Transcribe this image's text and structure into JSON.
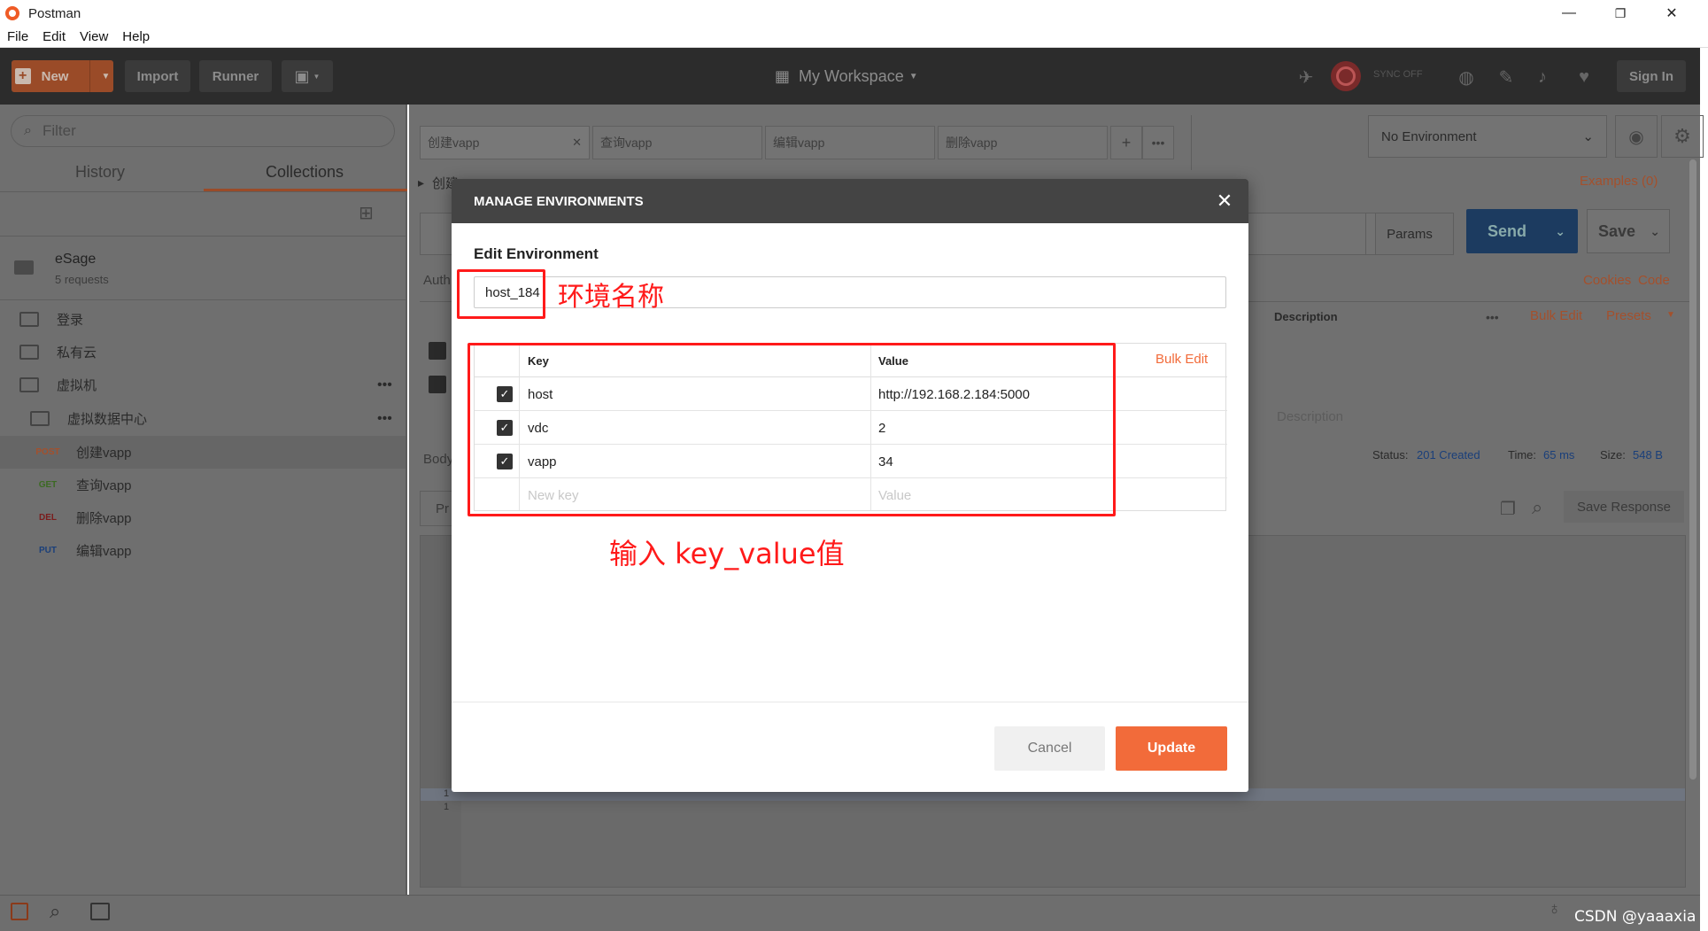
{
  "window": {
    "title": "Postman",
    "minimize": "—",
    "restore": "❐",
    "close": "✕"
  },
  "menu": [
    "File",
    "Edit",
    "View",
    "Help"
  ],
  "toolbar": {
    "new_label": "New",
    "new_icon": "plus-icon",
    "import_label": "Import",
    "runner_label": "Runner",
    "workspace_label": "My Workspace",
    "sync_label": "SYNC OFF",
    "signin_label": "Sign In"
  },
  "sidebar": {
    "filter_placeholder": "Filter",
    "tabs": [
      "History",
      "Collections"
    ],
    "collection": {
      "name": "eSage",
      "count": "5 requests"
    },
    "folders": [
      "登录",
      "私有云",
      "虚拟机",
      "虚拟数据中心"
    ],
    "requests": [
      {
        "method": "POST",
        "name": "创建vapp",
        "color": "#a4502c"
      },
      {
        "method": "GET",
        "name": "查询vapp",
        "color": "#3b6a22"
      },
      {
        "method": "DEL",
        "name": "删除vapp",
        "color": "#7a1d1d"
      },
      {
        "method": "PUT",
        "name": "编辑vapp",
        "color": "#1a3f7a"
      }
    ]
  },
  "main": {
    "tabs": [
      "创建vapp",
      "查询vapp",
      "编辑vapp",
      "删除vapp"
    ],
    "request_title": "创建",
    "env_select": "No Environment",
    "examples": "Examples (0)",
    "params": "Params",
    "send": "Send",
    "save": "Save",
    "cookies": "Cookies",
    "code": "Code",
    "auth_tab": "Auth",
    "description_col": "Description",
    "bulk_edit": "Bulk Edit",
    "presets": "Presets",
    "description_placeholder": "Description",
    "body_tab": "Body",
    "pretty_tab": "Pr",
    "status_label": "Status:",
    "status_value": "201 Created",
    "time_label": "Time:",
    "time_value": "65 ms",
    "size_label": "Size:",
    "size_value": "548 B",
    "save_response": "Save Response",
    "line_numbers": [
      "1",
      "1"
    ]
  },
  "modal": {
    "title": "MANAGE ENVIRONMENTS",
    "edit_label": "Edit Environment",
    "env_name": "host_184",
    "key_header": "Key",
    "value_header": "Value",
    "bulk_edit": "Bulk Edit",
    "rows": [
      {
        "key": "host",
        "value": "http://192.168.2.184:5000"
      },
      {
        "key": "vdc",
        "value": "2"
      },
      {
        "key": "vapp",
        "value": "34"
      }
    ],
    "new_key_placeholder": "New key",
    "new_value_placeholder": "Value",
    "cancel": "Cancel",
    "update": "Update"
  },
  "annotations": {
    "env_name_note": "环境名称",
    "kv_note": "输入 key_value值"
  },
  "watermark": "CSDN @yaaaxia",
  "colors": {
    "accent": "#f26b3a",
    "send": "#1c6fbf",
    "annotation": "#ff1a1a"
  }
}
